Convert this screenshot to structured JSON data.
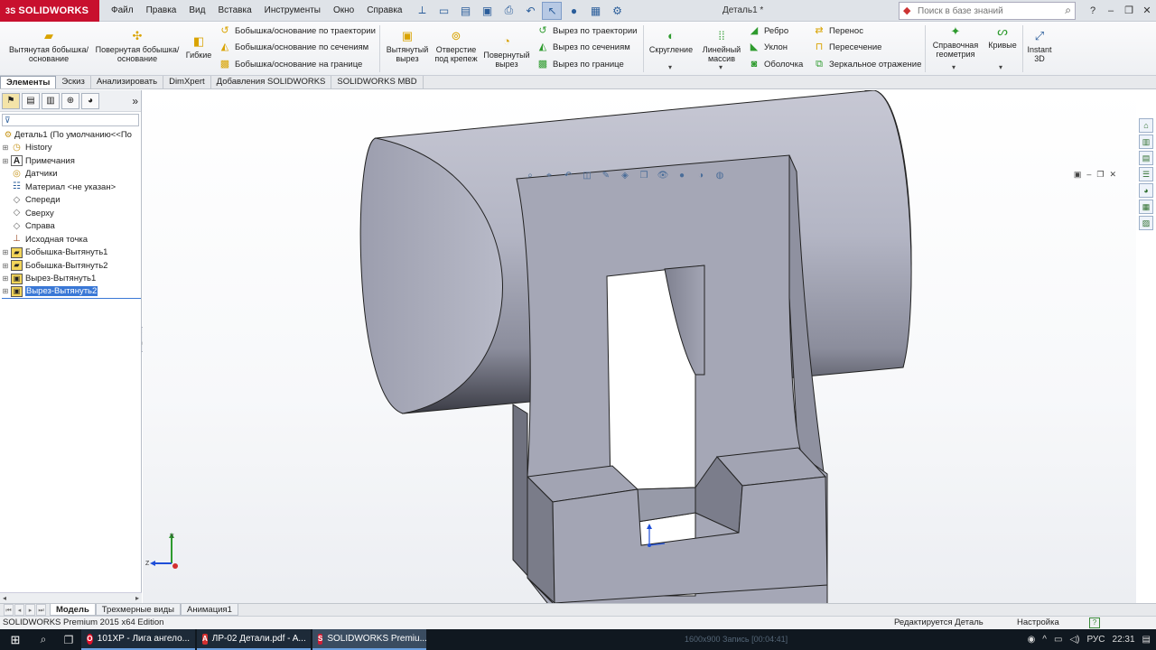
{
  "app": {
    "logo_text": "SOLIDWORKS",
    "logo_prefix": "3S",
    "document_title": "Деталь1 *",
    "menu": [
      "Файл",
      "Правка",
      "Вид",
      "Вставка",
      "Инструменты",
      "Окно",
      "Справка"
    ],
    "search_placeholder": "Поиск в базе знаний"
  },
  "ribbon": {
    "extrude_boss": "Вытянутая бобышка/основание",
    "revolve_boss": "Повернутая бобышка/основание",
    "flex": "Гибкие",
    "sweep_boss": "Бобышка/основание по траектории",
    "loft_boss": "Бобышка/основание по сечениям",
    "boundary_boss": "Бобышка/основание на границе",
    "extrude_cut": "Вытянутый вырез",
    "hole_wizard": "Отверстие под крепеж",
    "revolve_cut": "Повернутый вырез",
    "sweep_cut": "Вырез по траектории",
    "loft_cut": "Вырез по сечениям",
    "boundary_cut": "Вырез по границе",
    "fillet": "Скругление",
    "linear_pattern": "Линейный массив",
    "rib": "Ребро",
    "draft": "Уклон",
    "shell": "Оболочка",
    "wrap": "Перенос",
    "intersect": "Пересечение",
    "mirror": "Зеркальное отражение",
    "ref_geometry": "Справочная геометрия",
    "curves": "Кривые",
    "instant3d": "Instant 3D"
  },
  "tabs": [
    "Элементы",
    "Эскиз",
    "Анализировать",
    "DimXpert",
    "Добавления SOLIDWORKS",
    "SOLIDWORKS MBD"
  ],
  "tree": {
    "root": "Деталь1  (По умолчанию<<По",
    "items": [
      {
        "label": "History",
        "icon": "history-icon",
        "expandable": true
      },
      {
        "label": "Примечания",
        "icon": "annotations-icon",
        "expandable": true
      },
      {
        "label": "Датчики",
        "icon": "sensors-icon",
        "expandable": false
      },
      {
        "label": "Материал <не указан>",
        "icon": "material-icon",
        "expandable": false
      },
      {
        "label": "Спереди",
        "icon": "plane-icon",
        "expandable": false
      },
      {
        "label": "Сверху",
        "icon": "plane-icon",
        "expandable": false
      },
      {
        "label": "Справа",
        "icon": "plane-icon",
        "expandable": false
      },
      {
        "label": "Исходная точка",
        "icon": "origin-icon",
        "expandable": false
      },
      {
        "label": "Бобышка-Вытянуть1",
        "icon": "extrude-icon",
        "expandable": true
      },
      {
        "label": "Бобышка-Вытянуть2",
        "icon": "extrude-icon",
        "expandable": true
      },
      {
        "label": "Вырез-Вытянуть1",
        "icon": "cut-icon",
        "expandable": true
      },
      {
        "label": "Вырез-Вытянуть2",
        "icon": "cut-icon",
        "expandable": true,
        "selected": true
      }
    ]
  },
  "model_tabs": [
    "Модель",
    "Трехмерные виды",
    "Анимация1"
  ],
  "status": {
    "left": "SOLIDWORKS Premium 2015 x64 Edition",
    "mid": "Редактируется Деталь",
    "right": "Настройка"
  },
  "taskbar": {
    "apps": [
      {
        "label": "101XP - Лига ангело...",
        "icon": "opera-icon",
        "color": "#e0102a",
        "letter": "O"
      },
      {
        "label": "ЛР-02 Детали.pdf - A...",
        "icon": "pdf-icon",
        "color": "#d32f2f",
        "letter": "A"
      },
      {
        "label": "SOLIDWORKS Premiu...",
        "icon": "solidworks-icon",
        "color": "#d11f36",
        "letter": "S"
      }
    ],
    "lang": "РУС",
    "time": "22:31",
    "ghost_text": "1600х900     Запись [00:04:41]"
  },
  "triad": {
    "x_label": "Z",
    "y_label": "Y"
  },
  "colors": {
    "accent": "#3a78d6",
    "part": "#a8aab8",
    "brand": "#c8102e"
  }
}
